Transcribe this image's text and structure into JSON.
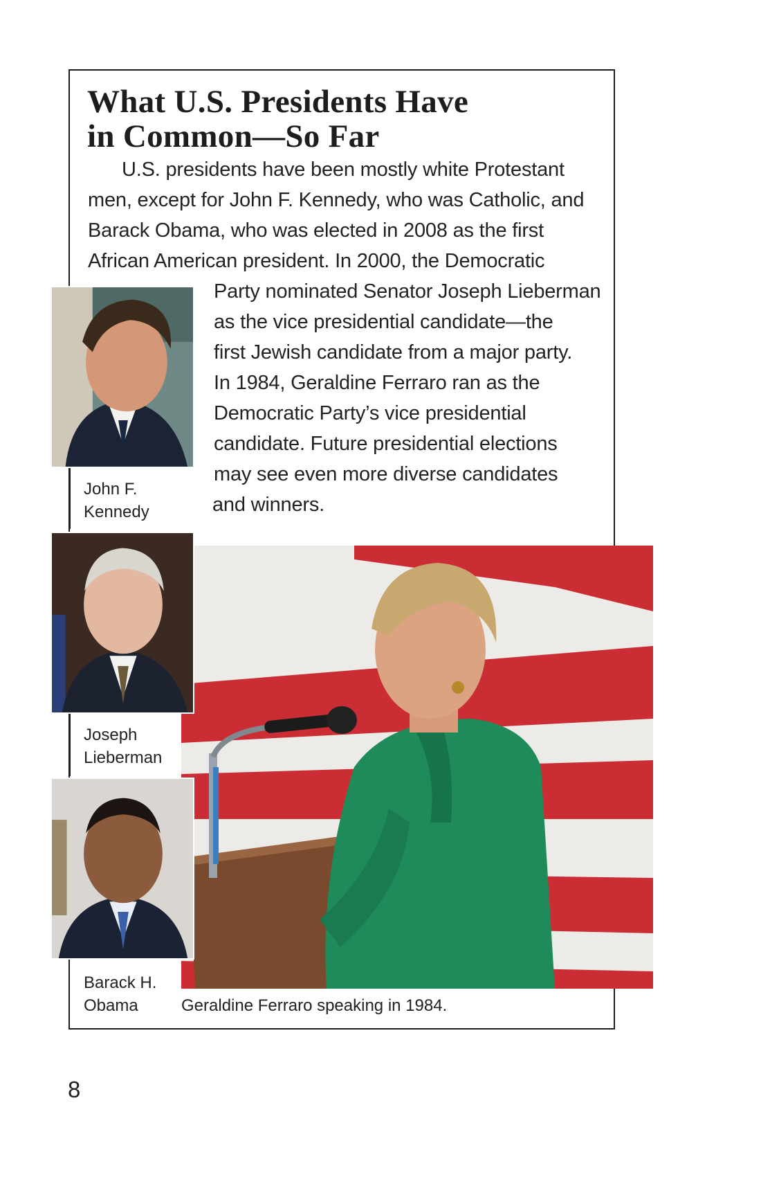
{
  "sidebar": {
    "title_lines": [
      "What U.S. Presidents Have",
      "in Common—So Far"
    ],
    "paragraph_lines": [
      "U.S. presidents have been mostly white Protestant",
      "men, except for John F. Kennedy, who was Catholic, and",
      "Barack Obama, who was elected in 2008 as the first",
      "African American president. In 2000, the Democratic",
      "Party nominated Senator Joseph Lieberman",
      "as the vice presidential candidate—the",
      "first Jewish candidate from a major party.",
      "In 1984, Geraldine Ferraro ran as the",
      "Democratic Party’s vice presidential",
      "candidate. Future presidential elections",
      "may see even more diverse candidates",
      "and winners."
    ]
  },
  "photos": {
    "kennedy": {
      "caption_lines": [
        "John F.",
        "Kennedy"
      ]
    },
    "lieberman": {
      "caption_lines": [
        "Joseph",
        "Lieberman"
      ]
    },
    "obama": {
      "caption_lines": [
        "Barack H.",
        "Obama"
      ]
    },
    "ferraro": {
      "caption": "Geraldine Ferraro speaking in 1984."
    }
  },
  "page_number": "8",
  "colors": {
    "frame": "#1d1d1d",
    "flag_red": "#c8262c",
    "blouse_green": "#1f8a5a"
  }
}
